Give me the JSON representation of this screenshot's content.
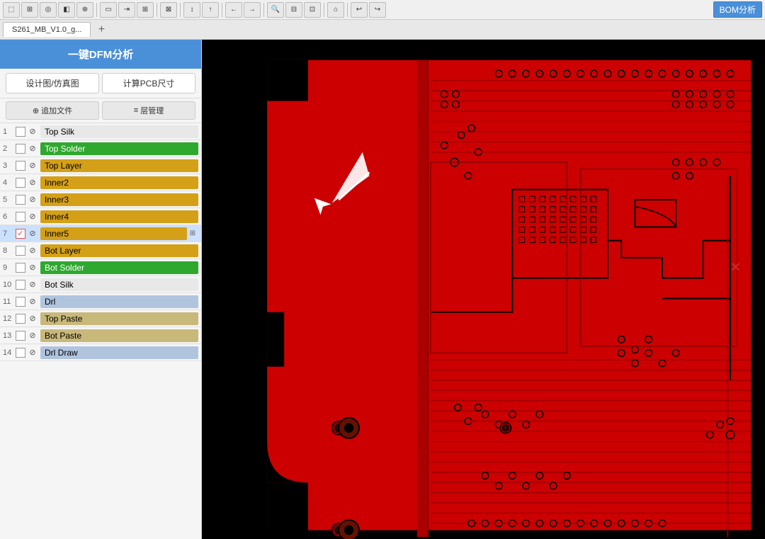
{
  "toolbar": {
    "bom_label": "BOM分析",
    "tab_label": "S261_MB_V1.0_g..."
  },
  "left_panel": {
    "dfm_title": "一键DFM分析",
    "btn_design": "设计图/仿真图",
    "btn_calc": "计算PCB尺寸",
    "btn_add_file": "追加文件",
    "btn_layer_mgmt": "层管理",
    "layers": [
      {
        "num": "1",
        "name": "Top Silk",
        "color": "#e8e8e8",
        "text_color": "#000",
        "checked": false,
        "selected": false
      },
      {
        "num": "2",
        "name": "Top Solder",
        "color": "#2ea82e",
        "text_color": "#fff",
        "checked": false,
        "selected": false
      },
      {
        "num": "3",
        "name": "Top Layer",
        "color": "#d4a017",
        "text_color": "#000",
        "checked": false,
        "selected": false
      },
      {
        "num": "4",
        "name": "Inner2",
        "color": "#d4a017",
        "text_color": "#000",
        "checked": false,
        "selected": false
      },
      {
        "num": "5",
        "name": "Inner3",
        "color": "#d4a017",
        "text_color": "#000",
        "checked": false,
        "selected": false
      },
      {
        "num": "6",
        "name": "Inner4",
        "color": "#d4a017",
        "text_color": "#000",
        "checked": false,
        "selected": false
      },
      {
        "num": "7",
        "name": "Inner5",
        "color": "#d4a017",
        "text_color": "#000",
        "checked": true,
        "selected": true
      },
      {
        "num": "8",
        "name": "Bot Layer",
        "color": "#d4a017",
        "text_color": "#000",
        "checked": false,
        "selected": false
      },
      {
        "num": "9",
        "name": "Bot Solder",
        "color": "#2ea82e",
        "text_color": "#fff",
        "checked": false,
        "selected": false
      },
      {
        "num": "10",
        "name": "Bot Silk",
        "color": "#e8e8e8",
        "text_color": "#000",
        "checked": false,
        "selected": false
      },
      {
        "num": "11",
        "name": "Drl",
        "color": "#b0c4de",
        "text_color": "#000",
        "checked": false,
        "selected": false
      },
      {
        "num": "12",
        "name": "Top Paste",
        "color": "#c8b87a",
        "text_color": "#000",
        "checked": false,
        "selected": false
      },
      {
        "num": "13",
        "name": "Bot Paste",
        "color": "#c8b87a",
        "text_color": "#000",
        "checked": false,
        "selected": false
      },
      {
        "num": "14",
        "name": "Drl Draw",
        "color": "#b0c4de",
        "text_color": "#000",
        "checked": false,
        "selected": false
      }
    ]
  },
  "pcb": {
    "background": "#000000",
    "board_color": "#cc0000"
  },
  "icons": {
    "add": "+",
    "layers": "≡",
    "eye": "👁",
    "check": "✓",
    "close": "✕",
    "expand": "⊞",
    "plus": "+"
  }
}
